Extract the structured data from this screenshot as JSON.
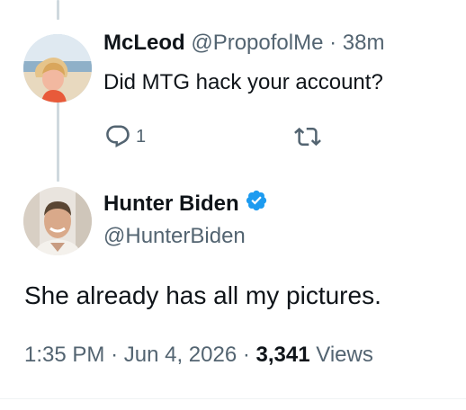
{
  "reply_tweet": {
    "display_name": "McLeod",
    "handle": "@PropofolMe",
    "separator": "·",
    "time_ago": "38m",
    "text": "Did MTG hack your account?",
    "reply_count": "1",
    "icons": {
      "reply": "comment-bubble-icon",
      "retweet": "retweet-icon"
    }
  },
  "main_tweet": {
    "display_name": "Hunter Biden",
    "handle": "@HunterBiden",
    "text": "She already has all my pictures.",
    "time": "1:35 PM",
    "date": "Jun 4, 2026",
    "separator": "·",
    "views_count": "3,341",
    "views_label": "Views",
    "verified": true
  },
  "colors": {
    "text_primary": "#0f1419",
    "text_secondary": "#536471",
    "thread_line": "#cfd9de",
    "verified_blue": "#1d9bf0",
    "divider": "#eff3f4"
  }
}
